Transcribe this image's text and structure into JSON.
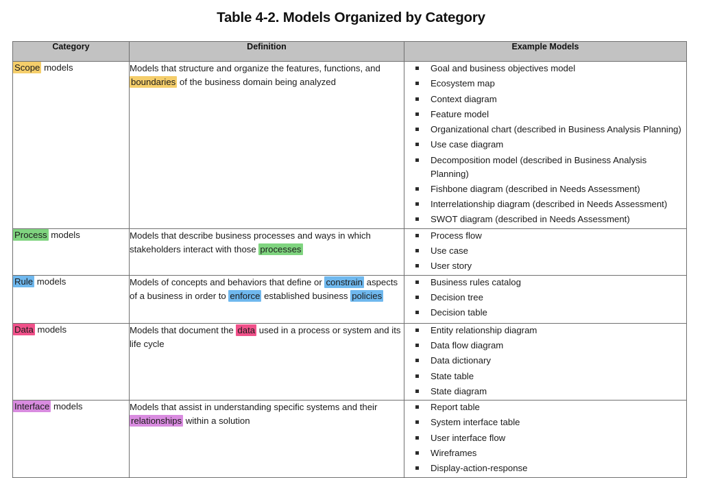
{
  "title": "Table 4-2. Models Organized by Category",
  "table": {
    "headers": {
      "category": "Category",
      "definition": "Definition",
      "examples": "Example Models"
    },
    "highlight_colors": {
      "scope": "#f5ce6b",
      "process": "#7fd47f",
      "rule": "#6fb8ee",
      "data": "#f0518a",
      "interface": "#d98ce0"
    },
    "rows": [
      {
        "key": "scope",
        "category_highlight": "Scope",
        "category_rest": " models",
        "definition_parts": [
          {
            "text": "Models that structure and organize the features, functions, and ",
            "highlight": false
          },
          {
            "text": "boundaries",
            "highlight": true
          },
          {
            "text": " of the business domain being analyzed",
            "highlight": false
          }
        ],
        "examples": [
          "Goal and business objectives model",
          "Ecosystem map",
          "Context diagram",
          "Feature model",
          "Organizational chart (described in Business Analysis Planning)",
          "Use case diagram",
          "Decomposition model (described in Business Analysis Planning)",
          "Fishbone diagram (described in Needs Assessment)",
          "Interrelationship diagram (described in Needs Assessment)",
          "SWOT diagram (described in Needs Assessment)"
        ]
      },
      {
        "key": "process",
        "category_highlight": "Process",
        "category_rest": " models",
        "definition_parts": [
          {
            "text": "Models that describe business processes and ways in which stakeholders interact with those ",
            "highlight": false
          },
          {
            "text": "processes",
            "highlight": true
          }
        ],
        "examples": [
          "Process flow",
          "Use case",
          "User story"
        ]
      },
      {
        "key": "rule",
        "category_highlight": "Rule",
        "category_rest": " models",
        "definition_parts": [
          {
            "text": "Models of concepts and behaviors that define or ",
            "highlight": false
          },
          {
            "text": "constrain",
            "highlight": true
          },
          {
            "text": " aspects of a business in order to ",
            "highlight": false
          },
          {
            "text": "enforce",
            "highlight": true
          },
          {
            "text": " established business ",
            "highlight": false
          },
          {
            "text": "policies",
            "highlight": true
          }
        ],
        "examples": [
          "Business rules catalog",
          "Decision tree",
          "Decision table"
        ]
      },
      {
        "key": "data",
        "category_highlight": "Data",
        "category_rest": " models",
        "definition_parts": [
          {
            "text": "Models that document the ",
            "highlight": false
          },
          {
            "text": "data",
            "highlight": true
          },
          {
            "text": " used in a process or system and its life cycle",
            "highlight": false
          }
        ],
        "examples": [
          "Entity relationship diagram",
          "Data flow diagram",
          "Data dictionary",
          "State table",
          "State diagram"
        ]
      },
      {
        "key": "interface",
        "category_highlight": "Interface",
        "category_rest": " models",
        "definition_parts": [
          {
            "text": "Models that assist in understanding specific systems and their ",
            "highlight": false
          },
          {
            "text": "relationships",
            "highlight": true
          },
          {
            "text": " within a solution",
            "highlight": false
          }
        ],
        "examples": [
          "Report table",
          "System interface table",
          "User interface flow",
          "Wireframes",
          "Display-action-response"
        ]
      }
    ]
  }
}
